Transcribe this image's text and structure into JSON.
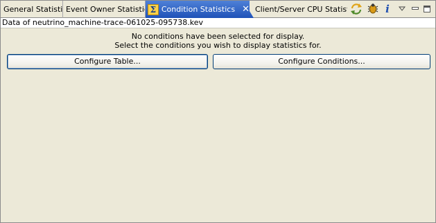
{
  "tabs": [
    {
      "label": "General Statistics"
    },
    {
      "label": "Event Owner Statistics"
    },
    {
      "label": "Condition Statistics",
      "active": true,
      "icon": "sigma-icon",
      "close": "✕"
    },
    {
      "label": "Client/Server CPU Statistics"
    }
  ],
  "toolbar": {
    "icons": [
      "sync-icon",
      "bug-icon",
      "info-icon",
      "view-menu-icon",
      "minimize-icon",
      "maximize-icon"
    ],
    "info_glyph": "i"
  },
  "source": {
    "label": "Data of neutrino_machine-trace-061025-095738.kev"
  },
  "message": {
    "line1": "No conditions have been selected for display.",
    "line2": "Select the conditions you wish to display statistics for."
  },
  "buttons": {
    "configure_table": "Configure Table...",
    "configure_conditions": "Configure Conditions..."
  },
  "colors": {
    "active_tab": "#1f52b8",
    "panel_background": "#ece9d8",
    "button_border": "#003c74"
  }
}
